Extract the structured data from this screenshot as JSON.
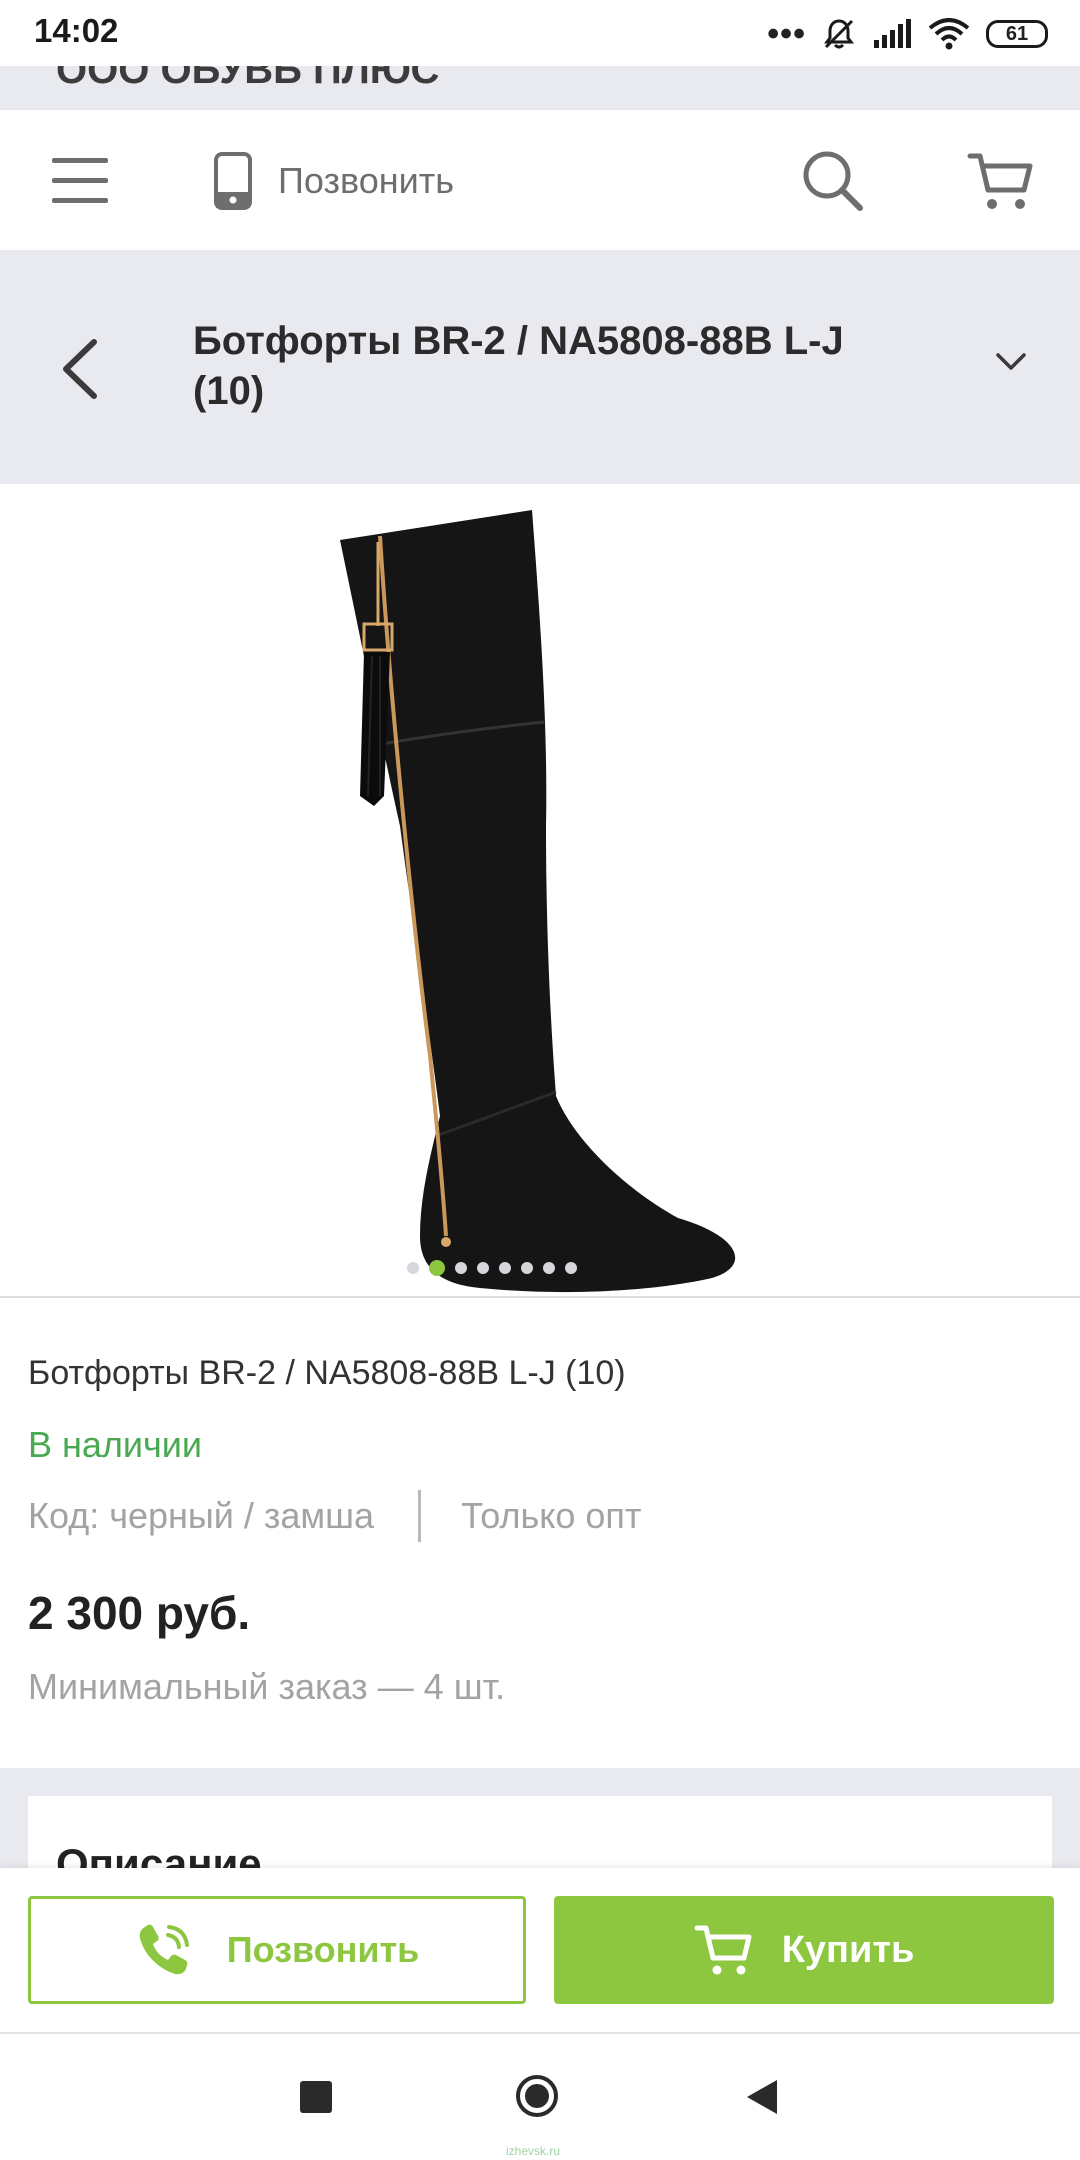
{
  "status_bar": {
    "time": "14:02",
    "battery": "61",
    "icons": [
      "dots-icon",
      "mute-icon",
      "signal-icon",
      "wifi-icon",
      "battery-icon"
    ]
  },
  "shop": {
    "name": "ООО ОБУВЬ ПЛЮС"
  },
  "header": {
    "call_label": "Позвонить",
    "icons": [
      "menu-icon",
      "phone-icon",
      "search-icon",
      "cart-icon"
    ]
  },
  "product": {
    "title": "Ботфорты BR-2 / NA5808-88B L-J (10)",
    "name": "Ботфорты BR-2 / NA5808-88B L-J (10)",
    "availability": "В наличии",
    "code": "Код: черный / замша",
    "wholesale": "Только опт",
    "price": "2 300 руб.",
    "min_order": "Минимальный заказ — 4 шт."
  },
  "gallery": {
    "total_images": 8,
    "active_index": 1
  },
  "description": {
    "title": "Описание"
  },
  "actions": {
    "call_label": "Позвонить",
    "buy_label": "Купить"
  },
  "watermark": "izhevsk.ru",
  "colors": {
    "accent": "#8dc63f",
    "in_stock": "#4aa850",
    "bar_bg": "#e9eaef"
  }
}
